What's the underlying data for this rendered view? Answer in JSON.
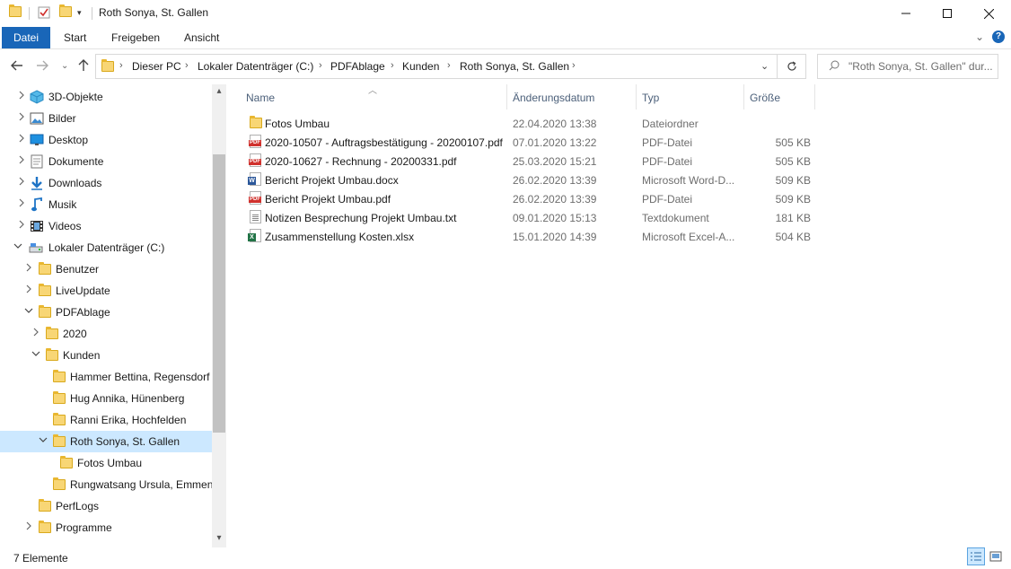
{
  "window": {
    "title": "Roth Sonya,  St. Gallen"
  },
  "ribbon": {
    "tabs": [
      "Datei",
      "Start",
      "Freigeben",
      "Ansicht"
    ]
  },
  "address": {
    "crumbs": [
      "Dieser PC",
      "Lokaler Datenträger (C:)",
      "PDFAblage",
      "Kunden",
      "Roth Sonya,  St. Gallen"
    ]
  },
  "search": {
    "placeholder": "\"Roth Sonya,  St. Gallen\" dur..."
  },
  "nav": {
    "items": [
      {
        "label": "3D-Objekte",
        "icon": "3d-objects-icon",
        "chevron": "›"
      },
      {
        "label": "Bilder",
        "icon": "pictures-icon",
        "chevron": "›"
      },
      {
        "label": "Desktop",
        "icon": "desktop-icon",
        "chevron": "›"
      },
      {
        "label": "Dokumente",
        "icon": "documents-icon",
        "chevron": "›"
      },
      {
        "label": "Downloads",
        "icon": "downloads-icon",
        "chevron": "›"
      },
      {
        "label": "Musik",
        "icon": "music-icon",
        "chevron": "›"
      },
      {
        "label": "Videos",
        "icon": "videos-icon",
        "chevron": "›"
      },
      {
        "label": "Lokaler Datenträger (C:)",
        "icon": "drive-icon",
        "chevron": "⌄"
      },
      {
        "label": "Benutzer",
        "icon": "folder-icon",
        "chevron": "›"
      },
      {
        "label": "LiveUpdate",
        "icon": "folder-icon",
        "chevron": "›"
      },
      {
        "label": "PDFAblage",
        "icon": "folder-icon",
        "chevron": "⌄"
      },
      {
        "label": "2020",
        "icon": "folder-icon",
        "chevron": "›"
      },
      {
        "label": "Kunden",
        "icon": "folder-icon",
        "chevron": "⌄"
      },
      {
        "label": "Hammer Bettina, Regensdorf",
        "icon": "folder-icon",
        "chevron": ""
      },
      {
        "label": "Hug Annika, Hünenberg",
        "icon": "folder-icon",
        "chevron": ""
      },
      {
        "label": "Ranni Erika, Hochfelden",
        "icon": "folder-icon",
        "chevron": ""
      },
      {
        "label": "Roth Sonya,  St. Gallen",
        "icon": "folder-icon",
        "chevron": "⌄"
      },
      {
        "label": "Fotos Umbau",
        "icon": "folder-icon",
        "chevron": ""
      },
      {
        "label": "Rungwatsang Ursula, Emmenb",
        "icon": "folder-icon",
        "chevron": ""
      },
      {
        "label": "PerfLogs",
        "icon": "folder-icon",
        "chevron": ""
      },
      {
        "label": "Programme",
        "icon": "folder-icon",
        "chevron": "›"
      }
    ]
  },
  "columns": {
    "name": "Name",
    "date": "Änderungsdatum",
    "type": "Typ",
    "size": "Größe"
  },
  "files": [
    {
      "name": "Fotos Umbau",
      "date": "22.04.2020 13:38",
      "type": "Dateiordner",
      "size": "",
      "icon": "folder-icon"
    },
    {
      "name": "2020-10507 - Auftragsbestätigung - 20200107.pdf",
      "date": "07.01.2020 13:22",
      "type": "PDF-Datei",
      "size": "505 KB",
      "icon": "pdf-icon"
    },
    {
      "name": "2020-10627 - Rechnung - 20200331.pdf",
      "date": "25.03.2020 15:21",
      "type": "PDF-Datei",
      "size": "505 KB",
      "icon": "pdf-icon"
    },
    {
      "name": "Bericht Projekt Umbau.docx",
      "date": "26.02.2020 13:39",
      "type": "Microsoft Word-D...",
      "size": "509 KB",
      "icon": "docx-icon"
    },
    {
      "name": "Bericht Projekt Umbau.pdf",
      "date": "26.02.2020 13:39",
      "type": "PDF-Datei",
      "size": "509 KB",
      "icon": "pdf-icon"
    },
    {
      "name": "Notizen Besprechung Projekt Umbau.txt",
      "date": "09.01.2020 15:13",
      "type": "Textdokument",
      "size": "181 KB",
      "icon": "txt-icon"
    },
    {
      "name": "Zusammenstellung Kosten.xlsx",
      "date": "15.01.2020 14:39",
      "type": "Microsoft Excel-A...",
      "size": "504 KB",
      "icon": "xlsx-icon"
    }
  ],
  "status": {
    "count": "7 Elemente"
  },
  "colors": {
    "accent": "#1966b8",
    "selection": "#cce8ff"
  }
}
